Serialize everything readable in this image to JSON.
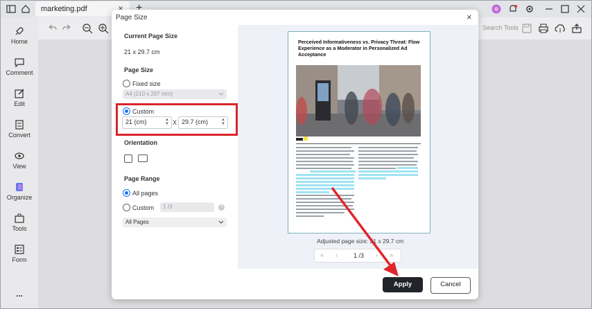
{
  "tab": {
    "title": "marketing.pdf",
    "close": "×"
  },
  "new_tab": "+",
  "sidebar": {
    "items": [
      {
        "label": "Home"
      },
      {
        "label": "Comment"
      },
      {
        "label": "Edit"
      },
      {
        "label": "Convert"
      },
      {
        "label": "View"
      },
      {
        "label": "Organize"
      },
      {
        "label": "Tools"
      },
      {
        "label": "Form"
      }
    ],
    "more": "..."
  },
  "toolbar": {
    "search_label": "Search Tools"
  },
  "dialog": {
    "title": "Page Size",
    "close": "×",
    "current_size_title": "Current Page Size",
    "current_size_value": "21 x 29.7 cm",
    "page_size_title": "Page Size",
    "fixed_size_label": "Fixed size",
    "fixed_size_value": "A4 (210 x 297 mm)",
    "custom_label": "Custom",
    "width_value": "21 (cm)",
    "x_separator": "X",
    "height_value": "29.7 (cm)",
    "orientation_title": "Orientation",
    "page_range_title": "Page Range",
    "all_pages_label": "All pages",
    "custom_range_label": "Custom",
    "custom_range_placeholder": "1 /3",
    "range_select_value": "All Pages",
    "adjusted_size": "Adjusted page size: 21 x 29.7 cm",
    "page_indicator": "1 /3",
    "apply_label": "Apply",
    "cancel_label": "Cancel"
  },
  "preview_doc": {
    "title": "Perceived Informativeness vs. Privacy Threat: Flow Experience as a Moderator in Personalized Ad Acceptance"
  },
  "colors": {
    "accent": "#1d6ff2",
    "highlight_box": "#d9252c",
    "apply_bg": "#22242b",
    "text_highlight": "#9fe3f2"
  }
}
